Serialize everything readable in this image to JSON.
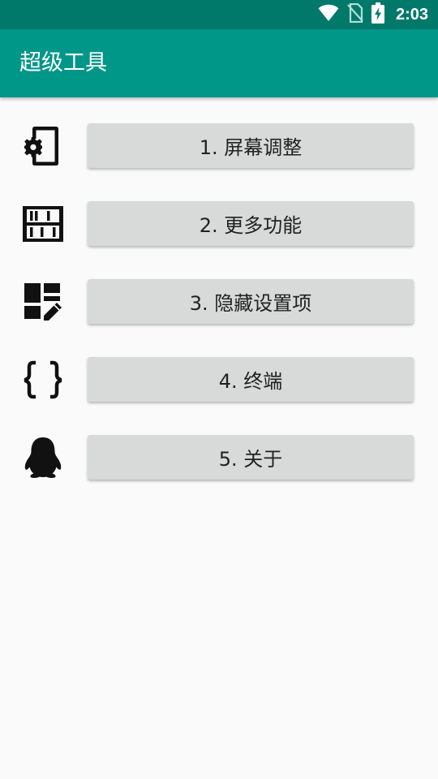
{
  "status_bar": {
    "time": "2:03",
    "icons": [
      "wifi-icon",
      "no-sim-icon",
      "battery-charging-icon"
    ]
  },
  "app_bar": {
    "title": "超级工具"
  },
  "menu": {
    "items": [
      {
        "label": "1. 屏幕调整",
        "icon": "phone-settings-icon"
      },
      {
        "label": "2. 更多功能",
        "icon": "abacus-icon"
      },
      {
        "label": "3. 隐藏设置项",
        "icon": "dashboard-edit-icon"
      },
      {
        "label": "4. 终端",
        "icon": "code-braces-icon"
      },
      {
        "label": "5. 关于",
        "icon": "qq-penguin-icon"
      }
    ]
  },
  "colors": {
    "status_bar": "#00796b",
    "app_bar": "#009688",
    "background": "#fafafa",
    "button": "#d8d9d9"
  }
}
